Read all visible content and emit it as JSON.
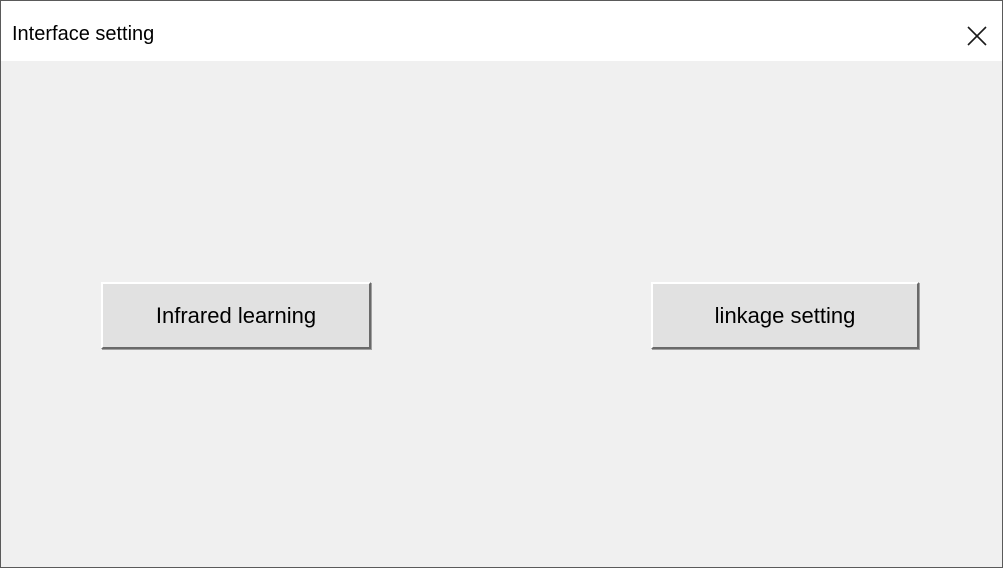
{
  "window": {
    "title": "Interface setting",
    "close_icon": "close-icon"
  },
  "buttons": {
    "infrared_learning": "Infrared learning",
    "linkage_setting": "linkage setting"
  }
}
